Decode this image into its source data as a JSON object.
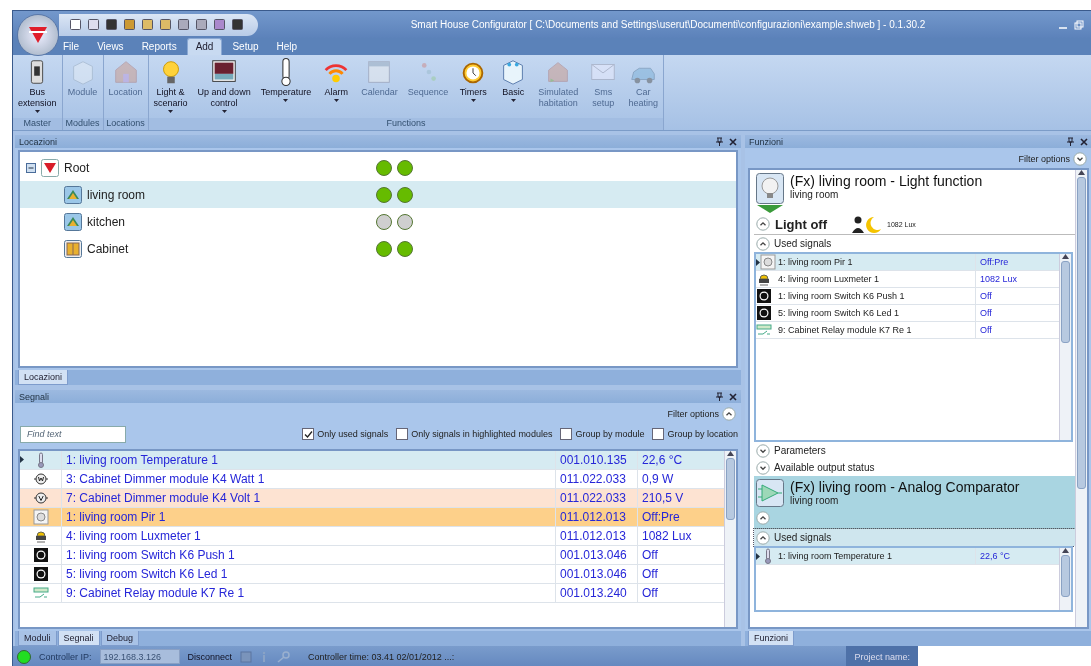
{
  "window": {
    "title": "Smart House Configurator [ C:\\Documents and Settings\\userut\\Documenti\\configurazioni\\example.shweb ] - 0.1.30.2"
  },
  "menu": [
    {
      "label": "File",
      "selected": false
    },
    {
      "label": "Views",
      "selected": false
    },
    {
      "label": "Reports",
      "selected": false
    },
    {
      "label": "Add",
      "selected": true
    },
    {
      "label": "Setup",
      "selected": false
    },
    {
      "label": "Help",
      "selected": false
    }
  ],
  "ribbon": [
    {
      "label": "Master",
      "buttons": [
        {
          "label": "Bus\nextension",
          "disabled": false,
          "dropdown": true
        }
      ]
    },
    {
      "label": "Modules",
      "buttons": [
        {
          "label": "Module",
          "disabled": true,
          "dropdown": false
        }
      ]
    },
    {
      "label": "Locations",
      "buttons": [
        {
          "label": "Location",
          "disabled": true,
          "dropdown": false
        }
      ]
    },
    {
      "label": "Functions",
      "buttons": [
        {
          "label": "Light &\nscenario",
          "disabled": false,
          "dropdown": true
        },
        {
          "label": "Up and down\ncontrol",
          "disabled": false,
          "dropdown": true
        },
        {
          "label": "Temperature",
          "disabled": false,
          "dropdown": true
        },
        {
          "label": "Alarm",
          "disabled": false,
          "dropdown": true
        },
        {
          "label": "Calendar",
          "disabled": true,
          "dropdown": false
        },
        {
          "label": "Sequence",
          "disabled": true,
          "dropdown": false
        },
        {
          "label": "Timers",
          "disabled": false,
          "dropdown": true
        },
        {
          "label": "Basic",
          "disabled": false,
          "dropdown": true
        },
        {
          "label": "Simulated\nhabitation",
          "disabled": true,
          "dropdown": false
        },
        {
          "label": "Sms\nsetup",
          "disabled": true,
          "dropdown": false
        },
        {
          "label": "Car\nheating",
          "disabled": true,
          "dropdown": false
        }
      ]
    }
  ],
  "locations_panel": {
    "title": "Locazioni",
    "tree": [
      {
        "label": "Root",
        "kind": "root",
        "selected": false,
        "expanded": true,
        "leds": [
          {
            "color": "#66bb00"
          },
          {
            "color": "#66bb00"
          }
        ],
        "children": [
          {
            "label": "living room",
            "kind": "room",
            "selected": true,
            "leds": [
              {
                "color": "#66bb00"
              },
              {
                "color": "#66bb00"
              }
            ]
          },
          {
            "label": "kitchen",
            "kind": "room",
            "selected": false,
            "leds": [
              {
                "color": "#cfcfcf"
              },
              {
                "color": "#cfcfcf"
              }
            ]
          },
          {
            "label": "Cabinet",
            "kind": "cabinet",
            "selected": false,
            "leds": [
              {
                "color": "#66bb00"
              },
              {
                "color": "#66bb00"
              }
            ]
          }
        ]
      }
    ],
    "tabs": [
      {
        "label": "Locazioni",
        "selected": true
      }
    ]
  },
  "signals_panel": {
    "title": "Segnali",
    "filter_options": "Filter options",
    "filters_expanded": true,
    "search": {
      "placeholder": "Find text"
    },
    "filters": [
      {
        "label": "Only used signals",
        "checked": true
      },
      {
        "label": "Only signals in highlighted modules",
        "checked": false
      },
      {
        "label": "Group by module",
        "checked": false
      },
      {
        "label": "Group by location",
        "checked": false
      }
    ],
    "rows": [
      {
        "kind": "temperature",
        "name": "1: living room Temperature 1",
        "address": "001.010.135",
        "value": "22,6 °C",
        "selected": true,
        "module_highlight": false,
        "signal_highlight": false
      },
      {
        "kind": "watt",
        "name": "3: Cabinet Dimmer module K4 Watt 1",
        "address": "011.022.033",
        "value": "0,9 W",
        "selected": false,
        "module_highlight": false,
        "signal_highlight": false
      },
      {
        "kind": "volt",
        "name": "7: Cabinet Dimmer module K4 Volt 1",
        "address": "011.022.033",
        "value": "210,5 V",
        "selected": false,
        "module_highlight": true,
        "signal_highlight": false
      },
      {
        "kind": "pir",
        "name": "1:  living room Pir 1",
        "address": "011.012.013",
        "value": "Off:Pre",
        "selected": false,
        "module_highlight": false,
        "signal_highlight": true
      },
      {
        "kind": "lux",
        "name": "4: living room Luxmeter 1",
        "address": "011.012.013",
        "value": "1082 Lux",
        "selected": false,
        "module_highlight": false,
        "signal_highlight": false
      },
      {
        "kind": "switch",
        "name": "1: living room Switch K6 Push 1",
        "address": "001.013.046",
        "value": "Off",
        "selected": false,
        "module_highlight": false,
        "signal_highlight": false
      },
      {
        "kind": "switch",
        "name": "5: living room Switch K6 Led 1",
        "address": "001.013.046",
        "value": "Off",
        "selected": false,
        "module_highlight": false,
        "signal_highlight": false
      },
      {
        "kind": "relay",
        "name": "9: Cabinet Relay module K7 Re 1",
        "address": "001.013.240",
        "value": "Off",
        "selected": false,
        "module_highlight": false,
        "signal_highlight": false
      }
    ],
    "tabs": [
      {
        "label": "Moduli",
        "selected": false
      },
      {
        "label": "Segnali",
        "selected": true
      },
      {
        "label": "Debug",
        "selected": false
      }
    ]
  },
  "functions_panel": {
    "title": "Funzioni",
    "filter_options": "Filter options",
    "filters_expanded": false,
    "functions": [
      {
        "kind": "light",
        "title": "(Fx) living room - Light function",
        "location": "living room",
        "selected": false,
        "status": {
          "expanded": true,
          "label": "Light off",
          "reading": "1082 Lux"
        },
        "used_signals": {
          "label": "Used signals",
          "expanded": true,
          "focused": false,
          "rows": [
            {
              "kind": "pir",
              "name": "1:  living room Pir 1",
              "value": "Off:Pre",
              "selected": true
            },
            {
              "kind": "lux",
              "name": "4: living room Luxmeter 1",
              "value": "1082 Lux",
              "selected": false
            },
            {
              "kind": "switch",
              "name": "1: living room Switch K6 Push 1",
              "value": "Off",
              "selected": false
            },
            {
              "kind": "switch",
              "name": "5: living room Switch K6 Led 1",
              "value": "Off",
              "selected": false
            },
            {
              "kind": "relay",
              "name": "9: Cabinet Relay module K7 Re 1",
              "value": "Off",
              "selected": false
            }
          ]
        },
        "sections": [
          {
            "label": "Parameters",
            "expanded": false
          },
          {
            "label": "Available output status",
            "expanded": false
          }
        ]
      },
      {
        "kind": "comparator",
        "title": "(Fx) living room - Analog Comparator",
        "location": "living room",
        "selected": true,
        "status": {
          "expanded": true
        },
        "used_signals": {
          "label": "Used signals",
          "expanded": true,
          "focused": true,
          "rows": [
            {
              "kind": "temperature",
              "name": "1: living room Temperature 1",
              "value": "22,6 °C",
              "selected": true
            }
          ]
        }
      }
    ],
    "tabs": [
      {
        "label": "Funzioni",
        "selected": true
      }
    ]
  },
  "status_bar": {
    "connected": true,
    "ip_label": "Controller IP:",
    "ip_value": "192.168.3.126",
    "disconnect": "Disconnect",
    "time": "Controller time: 03.41  02/01/2012 ...:",
    "project_label": "Project name:"
  }
}
